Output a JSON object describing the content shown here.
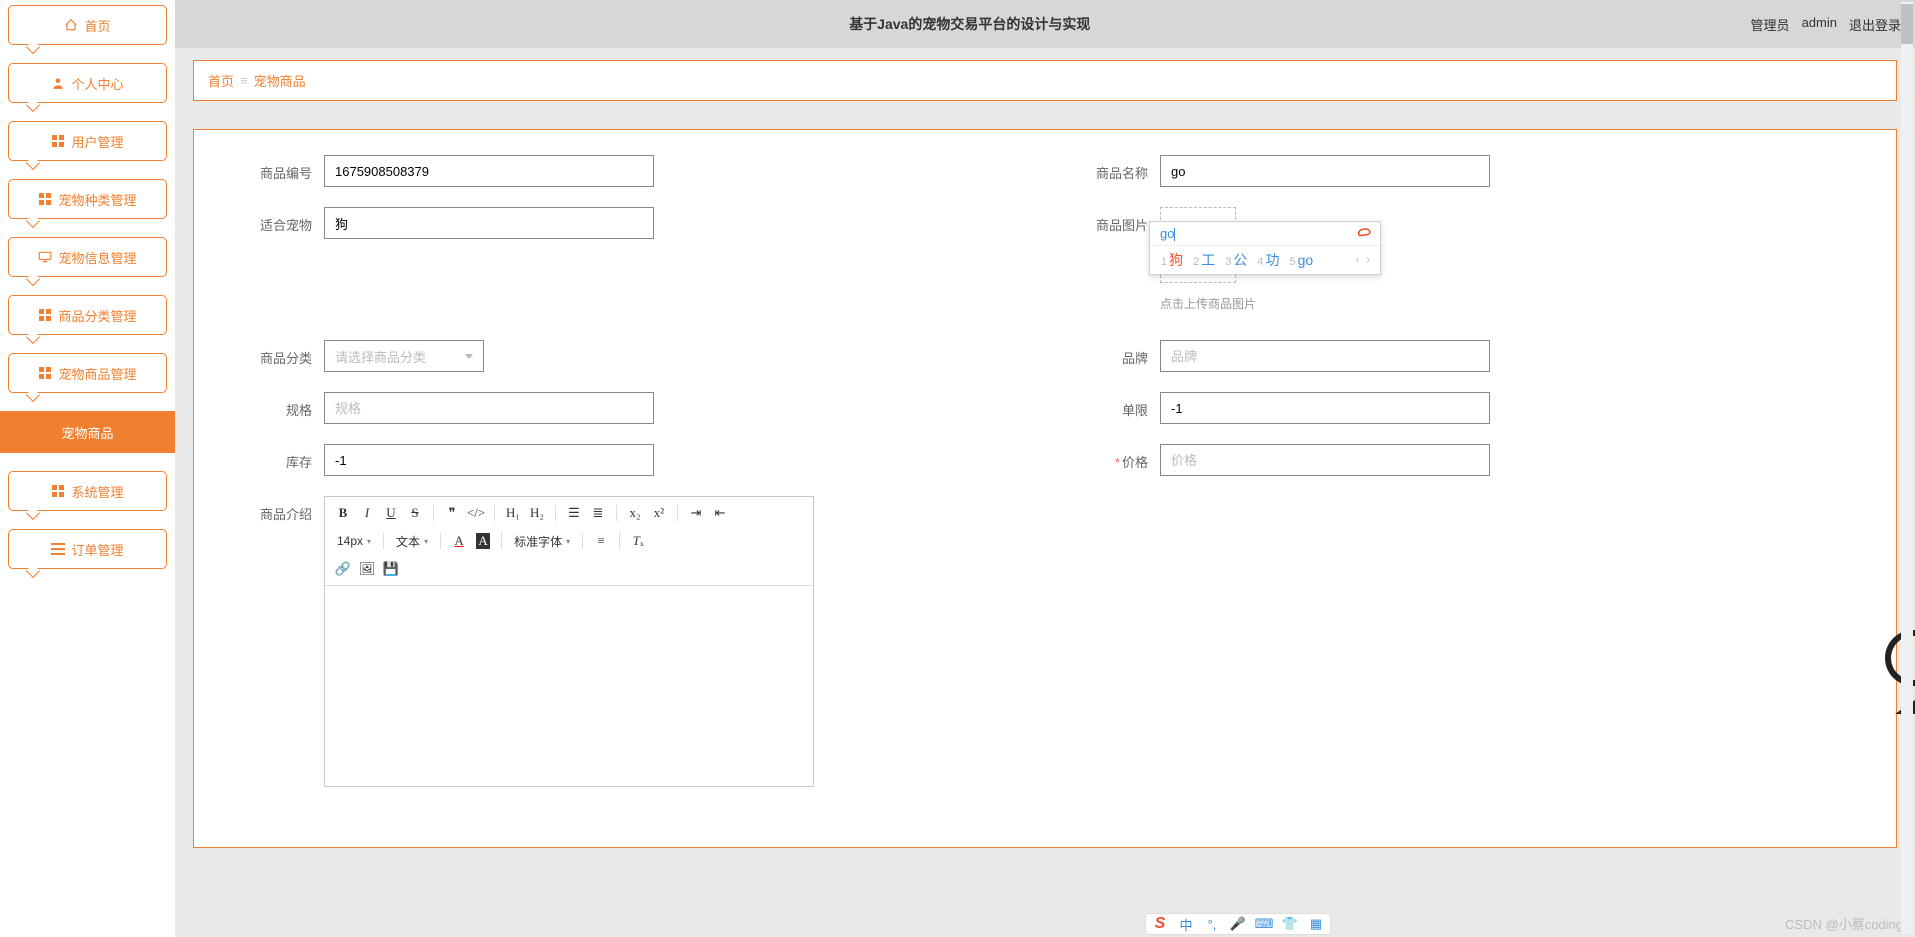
{
  "header": {
    "title": "基于Java的宠物交易平台的设计与实现",
    "role": "管理员",
    "user": "admin",
    "logout": "退出登录"
  },
  "sidebar": {
    "items": [
      {
        "label": "首页",
        "icon": "home-icon"
      },
      {
        "label": "个人中心",
        "icon": "user-icon"
      },
      {
        "label": "用户管理",
        "icon": "grid-icon"
      },
      {
        "label": "宠物种类管理",
        "icon": "grid-icon"
      },
      {
        "label": "宠物信息管理",
        "icon": "monitor-icon"
      },
      {
        "label": "商品分类管理",
        "icon": "grid-icon"
      },
      {
        "label": "宠物商品管理",
        "icon": "grid-icon"
      },
      {
        "label": "宠物商品",
        "icon": ""
      },
      {
        "label": "系统管理",
        "icon": "grid-icon"
      },
      {
        "label": "订单管理",
        "icon": "list-icon"
      }
    ],
    "active_index": 7
  },
  "breadcrumb": {
    "home": "首页",
    "current": "宠物商品"
  },
  "form": {
    "product_no": {
      "label": "商品编号",
      "value": "1675908508379"
    },
    "product_name": {
      "label": "商品名称",
      "value": "go"
    },
    "pet_suitable": {
      "label": "适合宠物",
      "value": "狗"
    },
    "product_image": {
      "label": "商品图片",
      "hint": "点击上传商品图片"
    },
    "category": {
      "label": "商品分类",
      "placeholder": "请选择商品分类"
    },
    "brand": {
      "label": "品牌",
      "placeholder": "品牌"
    },
    "spec": {
      "label": "规格",
      "placeholder": "规格"
    },
    "limit": {
      "label": "单限",
      "value": "-1"
    },
    "stock": {
      "label": "库存",
      "value": "-1"
    },
    "price": {
      "label": "价格",
      "placeholder": "价格",
      "required": true
    },
    "description": {
      "label": "商品介绍"
    }
  },
  "editor_toolbar": {
    "font_size": "14px",
    "group1": "文本",
    "font_family": "标准字体"
  },
  "ime": {
    "input": "go",
    "candidates": [
      {
        "n": "1",
        "w": "狗",
        "sel": true
      },
      {
        "n": "2",
        "w": "工"
      },
      {
        "n": "3",
        "w": "公"
      },
      {
        "n": "4",
        "w": "功"
      },
      {
        "n": "5",
        "w": "go"
      }
    ],
    "pager": "‹  ›",
    "bar": {
      "lang": "中"
    }
  },
  "watermark": "CSDN @小蔡coding"
}
